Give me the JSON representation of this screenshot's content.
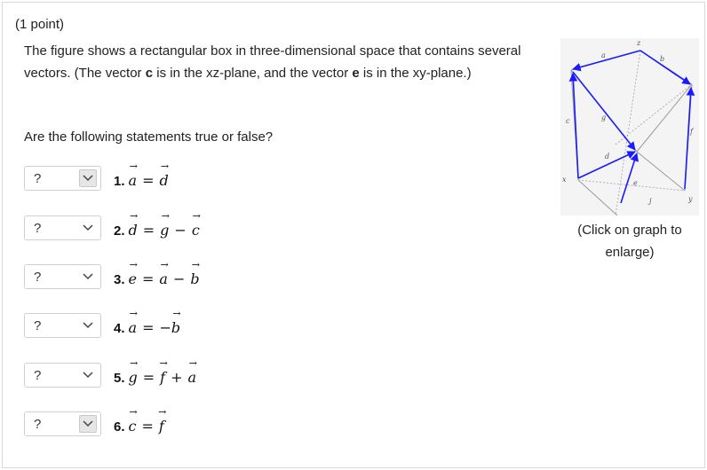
{
  "points": "(1 point)",
  "intro": {
    "part1": "The figure shows a rectangular box in three-dimensional space that contains several vectors. (The vector ",
    "c": "c",
    "part2": " is in the xz-plane, and the vector ",
    "e": "e",
    "part3": " is in the xy-plane.)"
  },
  "question": "Are the following statements true or false?",
  "statements": [
    {
      "select": "?",
      "num": "1.",
      "lhs": "a",
      "op1": "=",
      "r1": "d",
      "op2": "",
      "r2": "",
      "neg": ""
    },
    {
      "select": "?",
      "num": "2.",
      "lhs": "d",
      "op1": "=",
      "r1": "g",
      "op2": "−",
      "r2": "c",
      "neg": ""
    },
    {
      "select": "?",
      "num": "3.",
      "lhs": "e",
      "op1": "=",
      "r1": "a",
      "op2": "−",
      "r2": "b",
      "neg": ""
    },
    {
      "select": "?",
      "num": "4.",
      "lhs": "a",
      "op1": "=",
      "r1": "b",
      "op2": "",
      "r2": "",
      "neg": "−"
    },
    {
      "select": "?",
      "num": "5.",
      "lhs": "g",
      "op1": "=",
      "r1": "f",
      "op2": "+",
      "r2": "a",
      "neg": ""
    },
    {
      "select": "?",
      "num": "6.",
      "lhs": "c",
      "op1": "=",
      "r1": "f",
      "op2": "",
      "r2": "",
      "neg": ""
    }
  ],
  "figure": {
    "labels": {
      "a": "a",
      "b": "b",
      "c": "c",
      "d": "d",
      "e": "e",
      "f": "f",
      "g": "g",
      "j": "j",
      "x": "x",
      "y": "y",
      "z": "z"
    },
    "colors": {
      "vector": "#1a1aff",
      "box": "#999999",
      "background": "#f4f4f4"
    }
  },
  "caption": "(Click on graph to enlarge)"
}
